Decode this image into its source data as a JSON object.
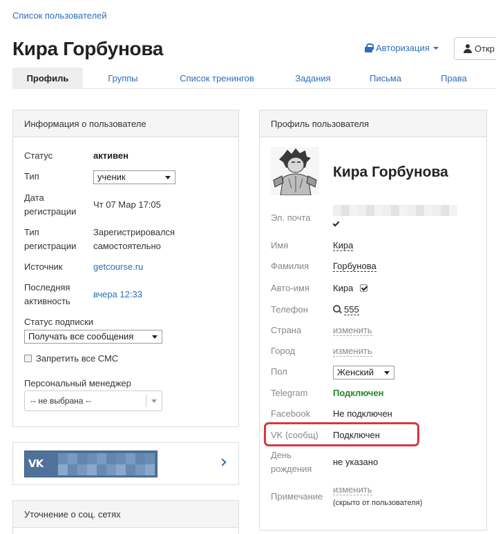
{
  "breadcrumb": "Список пользователей",
  "page_title": "Кира Горбунова",
  "header": {
    "auth_label": "Авторизация",
    "open_label": "Откр"
  },
  "tabs": [
    {
      "label": "Профиль",
      "active": true
    },
    {
      "label": "Группы"
    },
    {
      "label": "Список тренингов"
    },
    {
      "label": "Задания"
    },
    {
      "label": "Письма"
    },
    {
      "label": "Права"
    }
  ],
  "info_panel": {
    "title": "Информация о пользователе",
    "status_label": "Статус",
    "status_value": "активен",
    "type_label": "Тип",
    "type_value": "ученик",
    "reg_date_label_1": "Дата",
    "reg_date_label_2": "регистрации",
    "reg_date_value": "Чт 07 Мар 17:05",
    "reg_type_label_1": "Тип",
    "reg_type_label_2": "регистрации",
    "reg_type_value_1": "Зарегистрировался",
    "reg_type_value_2": "самостоятельно",
    "source_label": "Источник",
    "source_value": "getcourse.ru",
    "last_activity_label_1": "Последняя",
    "last_activity_label_2": "активность",
    "last_activity_value": "вчера 12:33",
    "subscription_label": "Статус подписки",
    "subscription_value": "Получать все сообщения",
    "sms_label": "Запретить все СМС",
    "manager_label": "Персональный менеджер",
    "manager_value": "-- не выбрана --"
  },
  "vk_panel": {
    "logo": "VK"
  },
  "social_panel": {
    "title": "Уточнение о соц. сетях"
  },
  "profile_panel": {
    "title": "Профиль пользователя",
    "name": "Кира Горбунова",
    "email_label": "Эл. почта",
    "first_name_label": "Имя",
    "first_name_value": "Кира",
    "last_name_label": "Фамилия",
    "last_name_value": "Горбунова",
    "autoname_label": "Авто-имя",
    "autoname_value": "Кира",
    "phone_label": "Телефон",
    "phone_value": "555",
    "country_label": "Страна",
    "country_value": "изменить",
    "city_label": "Город",
    "city_value": "изменить",
    "gender_label": "Пол",
    "gender_value": "Женский",
    "telegram_label": "Telegram",
    "telegram_value": "Подключен",
    "facebook_label": "Facebook",
    "facebook_value": "Не подключен",
    "vk_label": "VK (сообщ)",
    "vk_value": "Подключен",
    "birthday_label_1": "День",
    "birthday_label_2": "рождения",
    "birthday_value": "не указано",
    "note_label": "Примечание",
    "note_value": "изменить",
    "note_hint": "(скрыто от пользователя)"
  },
  "colors": {
    "link": "#2a6ebb",
    "connected": "#1e8a1e",
    "highlight": "#d9363e",
    "vk": "#4f719a"
  }
}
